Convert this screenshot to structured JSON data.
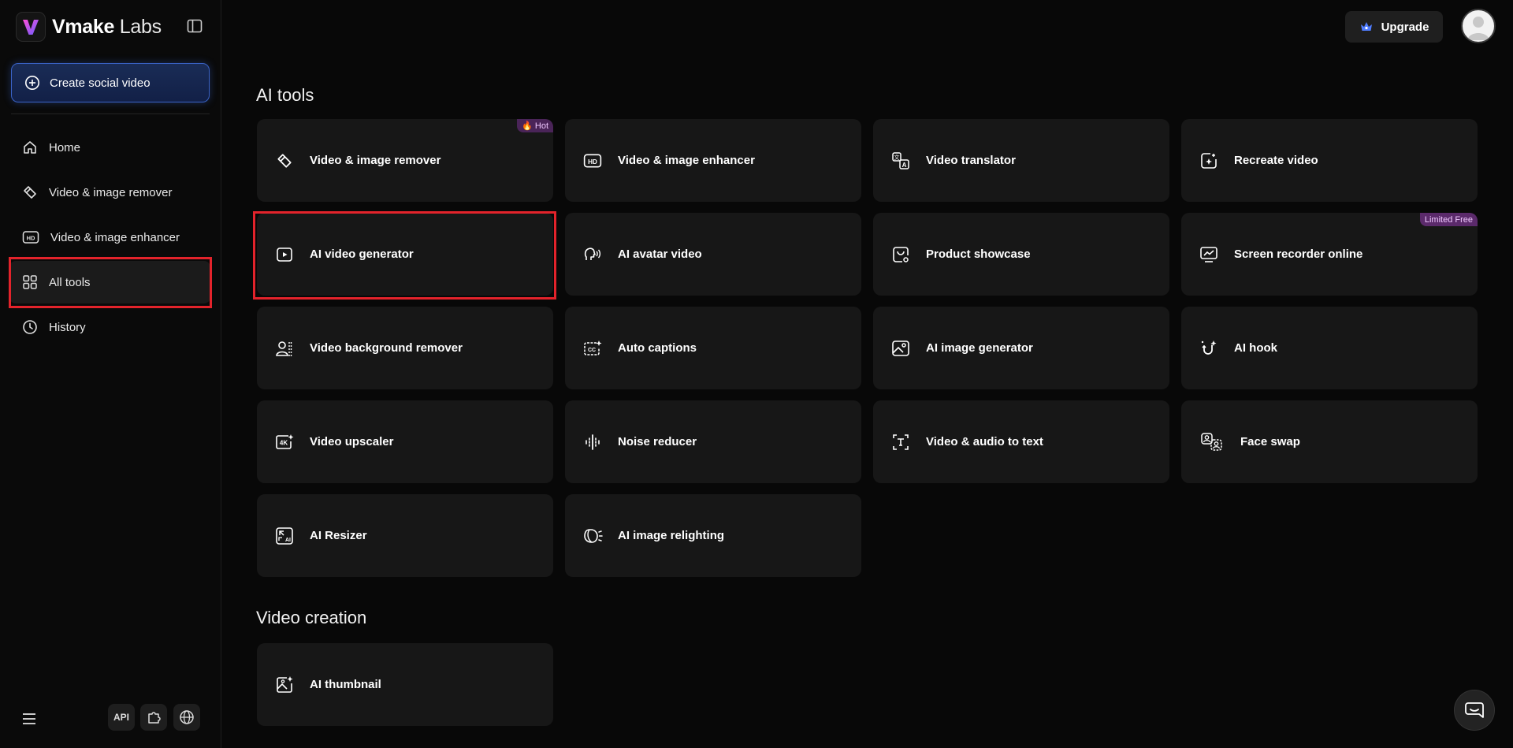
{
  "sidebar": {
    "logo": {
      "brand": "Vmake",
      "suffix": "Labs"
    },
    "create_button": "Create social video",
    "nav": [
      {
        "label": "Home",
        "icon": "home-icon"
      },
      {
        "label": "Video & image remover",
        "icon": "eraser-icon"
      },
      {
        "label": "Video & image enhancer",
        "icon": "hd-icon"
      },
      {
        "label": "All tools",
        "icon": "grid-icon",
        "active": true
      },
      {
        "label": "History",
        "icon": "clock-icon"
      }
    ],
    "bottom": {
      "api_label": "API"
    }
  },
  "header": {
    "upgrade_label": "Upgrade"
  },
  "sections": [
    {
      "title": "AI tools",
      "tools": [
        {
          "label": "Video & image remover",
          "icon": "eraser-icon",
          "badge": "🔥 Hot"
        },
        {
          "label": "Video & image enhancer",
          "icon": "hd-icon"
        },
        {
          "label": "Video translator",
          "icon": "translate-icon"
        },
        {
          "label": "Recreate video",
          "icon": "recreate-icon"
        },
        {
          "label": "AI video generator",
          "icon": "play-icon"
        },
        {
          "label": "AI avatar video",
          "icon": "avatar-speak-icon"
        },
        {
          "label": "Product showcase",
          "icon": "product-icon"
        },
        {
          "label": "Screen recorder online",
          "icon": "screen-chart-icon",
          "badge": "Limited Free"
        },
        {
          "label": "Video background remover",
          "icon": "person-bg-icon"
        },
        {
          "label": "Auto captions",
          "icon": "cc-icon"
        },
        {
          "label": "AI image generator",
          "icon": "image-icon"
        },
        {
          "label": "AI hook",
          "icon": "hook-icon"
        },
        {
          "label": "Video upscaler",
          "icon": "4k-icon"
        },
        {
          "label": "Noise reducer",
          "icon": "waveform-icon"
        },
        {
          "label": "Video & audio to text",
          "icon": "text-cursor-icon"
        },
        {
          "label": "Face swap",
          "icon": "face-swap-icon"
        },
        {
          "label": "AI Resizer",
          "icon": "resize-icon"
        },
        {
          "label": "AI image relighting",
          "icon": "relight-icon"
        }
      ]
    },
    {
      "title": "Video creation",
      "tools": [
        {
          "label": "AI thumbnail",
          "icon": "thumbnail-icon"
        }
      ]
    }
  ],
  "colors": {
    "highlight": "#e3232b",
    "accent_blue": "#3a63c7",
    "badge": "#5b2a6b"
  }
}
